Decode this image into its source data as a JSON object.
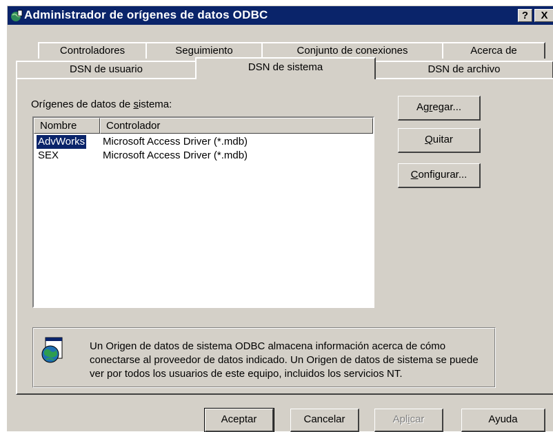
{
  "window": {
    "title": "Administrador de orígenes de datos ODBC",
    "help_button": "?",
    "close_button": "X"
  },
  "tabs": {
    "back_row": [
      "Controladores",
      "Seguimiento",
      "Conjunto de conexiones",
      "Acerca de"
    ],
    "front_row": [
      "DSN de usuario",
      "DSN de sistema",
      "DSN de archivo"
    ],
    "active": "DSN de sistema"
  },
  "panel": {
    "list_label_pre": "Orígenes de datos de ",
    "list_label_accel": "s",
    "list_label_post": "istema:",
    "columns": [
      "Nombre",
      "Controlador"
    ],
    "rows": [
      {
        "name": "AdvWorks",
        "driver": "Microsoft Access Driver (*.mdb)",
        "selected": true
      },
      {
        "name": "SEX",
        "driver": "Microsoft Access Driver (*.mdb)",
        "selected": false
      }
    ],
    "buttons": {
      "add": {
        "pre": "Ag",
        "accel": "r",
        "post": "egar..."
      },
      "remove": {
        "pre": "",
        "accel": "Q",
        "post": "uitar"
      },
      "configure": {
        "pre": "",
        "accel": "C",
        "post": "onfigurar..."
      }
    },
    "info_text": "Un Origen de datos de sistema ODBC almacena información acerca de cómo conectarse al proveedor de datos indicado. Un Origen de datos de sistema se puede ver por todos los usuarios de este equipo, incluidos los servicios NT."
  },
  "footer": {
    "ok": "Aceptar",
    "cancel": "Cancelar",
    "apply_pre": "Apl",
    "apply_accel": "i",
    "apply_post": "car",
    "help": "Ayuda"
  },
  "colors": {
    "titlebar": "#0a246a",
    "face": "#d4d0c8",
    "selection": "#0a246a"
  },
  "icons": {
    "title_icon": "odbc-globe-icon",
    "info_icon": "data-source-globe-icon"
  }
}
